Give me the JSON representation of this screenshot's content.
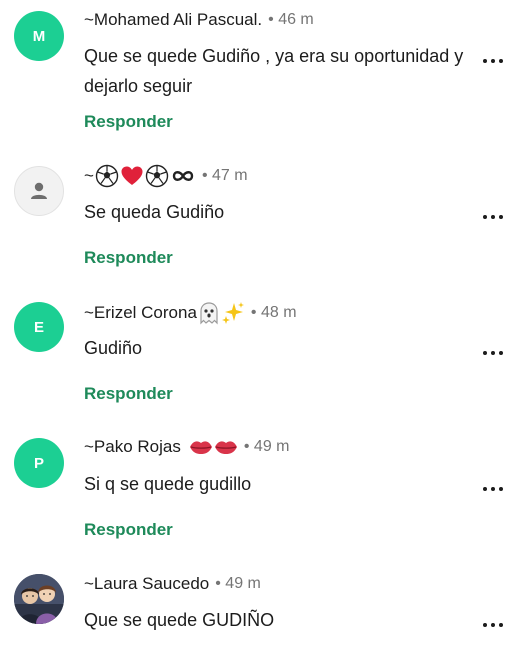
{
  "comments": [
    {
      "avatar_letter": "M",
      "author": "~Mohamed Ali Pascual.",
      "time": "• 46 m",
      "text": "Que se quede Gudiño , ya era su oportunidad y dejarlo seguir",
      "reply_label": "Responder"
    },
    {
      "avatar_letter": "",
      "author": "~",
      "author_emojis": [
        "soccer-ball",
        "red-heart",
        "soccer-ball",
        "infinity"
      ],
      "time": "• 47 m",
      "text": "Se queda Gudiño",
      "reply_label": "Responder"
    },
    {
      "avatar_letter": "E",
      "author": "~Erizel Corona",
      "author_emojis": [
        "ghost",
        "sparkles"
      ],
      "time": "• 48 m",
      "text": "Gudiño",
      "reply_label": "Responder"
    },
    {
      "avatar_letter": "P",
      "author": "~Pako Rojas",
      "author_emojis": [
        "lips",
        "lips"
      ],
      "time": "• 49 m",
      "text": "Si q se quede gudillo",
      "reply_label": "Responder"
    },
    {
      "avatar_letter": "",
      "author": "~Laura Saucedo",
      "time": "• 49 m",
      "text": "Que se quede GUDIÑO",
      "reply_label": ""
    }
  ],
  "colors": {
    "avatar_green": "#1ccf93",
    "reply_green": "#1e8a5a",
    "time_gray": "#757575"
  },
  "icons": {
    "more": "more-horizontal-icon",
    "blank_avatar": "person-icon"
  }
}
